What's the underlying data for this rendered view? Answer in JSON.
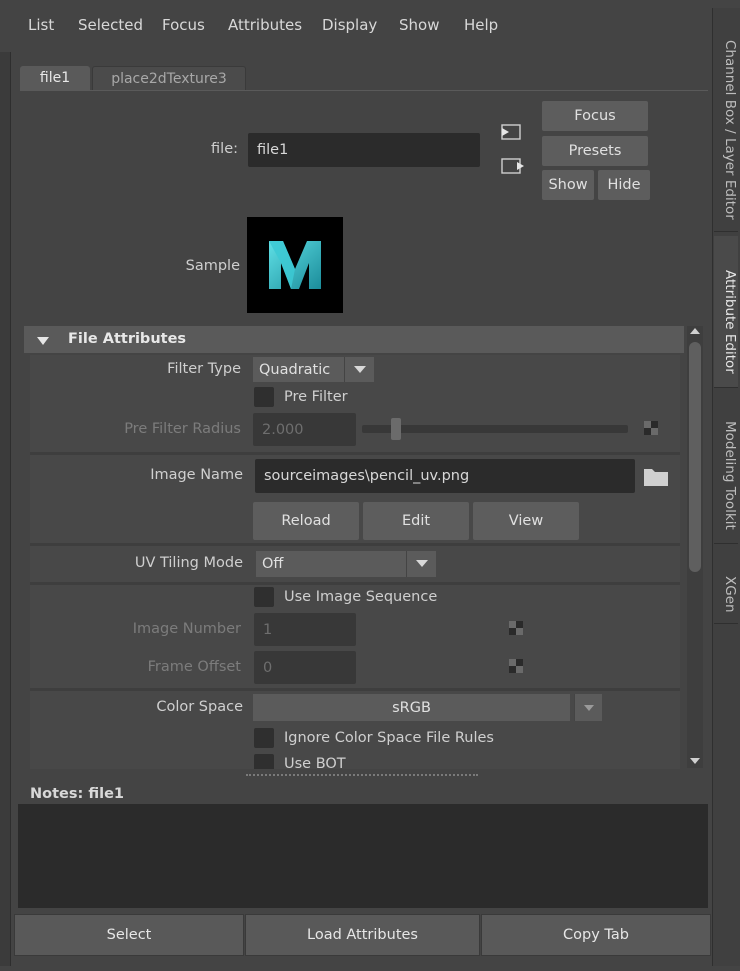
{
  "menu": [
    "List",
    "Selected",
    "Focus",
    "Attributes",
    "Display",
    "Show",
    "Help"
  ],
  "side_tabs": [
    "Channel Box / Layer Editor",
    "Attribute Editor",
    "Modeling Toolkit",
    "XGen"
  ],
  "node_tabs": [
    "file1",
    "place2dTexture3"
  ],
  "header": {
    "file_label": "file:",
    "file_value": "file1",
    "focus": "Focus",
    "presets": "Presets",
    "show": "Show",
    "hide": "Hide",
    "sample_label": "Sample"
  },
  "section": {
    "title": "File Attributes",
    "filter_type_label": "Filter Type",
    "filter_type_value": "Quadratic",
    "pre_filter_label": "Pre Filter",
    "pre_filter_radius_label": "Pre Filter Radius",
    "pre_filter_radius_value": "2.000",
    "image_name_label": "Image Name",
    "image_name_value": "sourceimages\\pencil_uv.png",
    "reload": "Reload",
    "edit": "Edit",
    "view": "View",
    "uv_tiling_label": "UV Tiling Mode",
    "uv_tiling_value": "Off",
    "use_image_sequence_label": "Use Image Sequence",
    "image_number_label": "Image Number",
    "image_number_value": "1",
    "frame_offset_label": "Frame Offset",
    "frame_offset_value": "0",
    "color_space_label": "Color Space",
    "color_space_value": "sRGB",
    "ignore_cs_label": "Ignore Color Space File Rules",
    "use_bot_label": "Use BOT"
  },
  "notes": {
    "label": "Notes:",
    "value": "file1"
  },
  "bottom": [
    "Select",
    "Load Attributes",
    "Copy Tab"
  ],
  "colors": {
    "background": "#444444",
    "field": "#2b2b2b",
    "logo_teal": "#2ab0c0"
  }
}
